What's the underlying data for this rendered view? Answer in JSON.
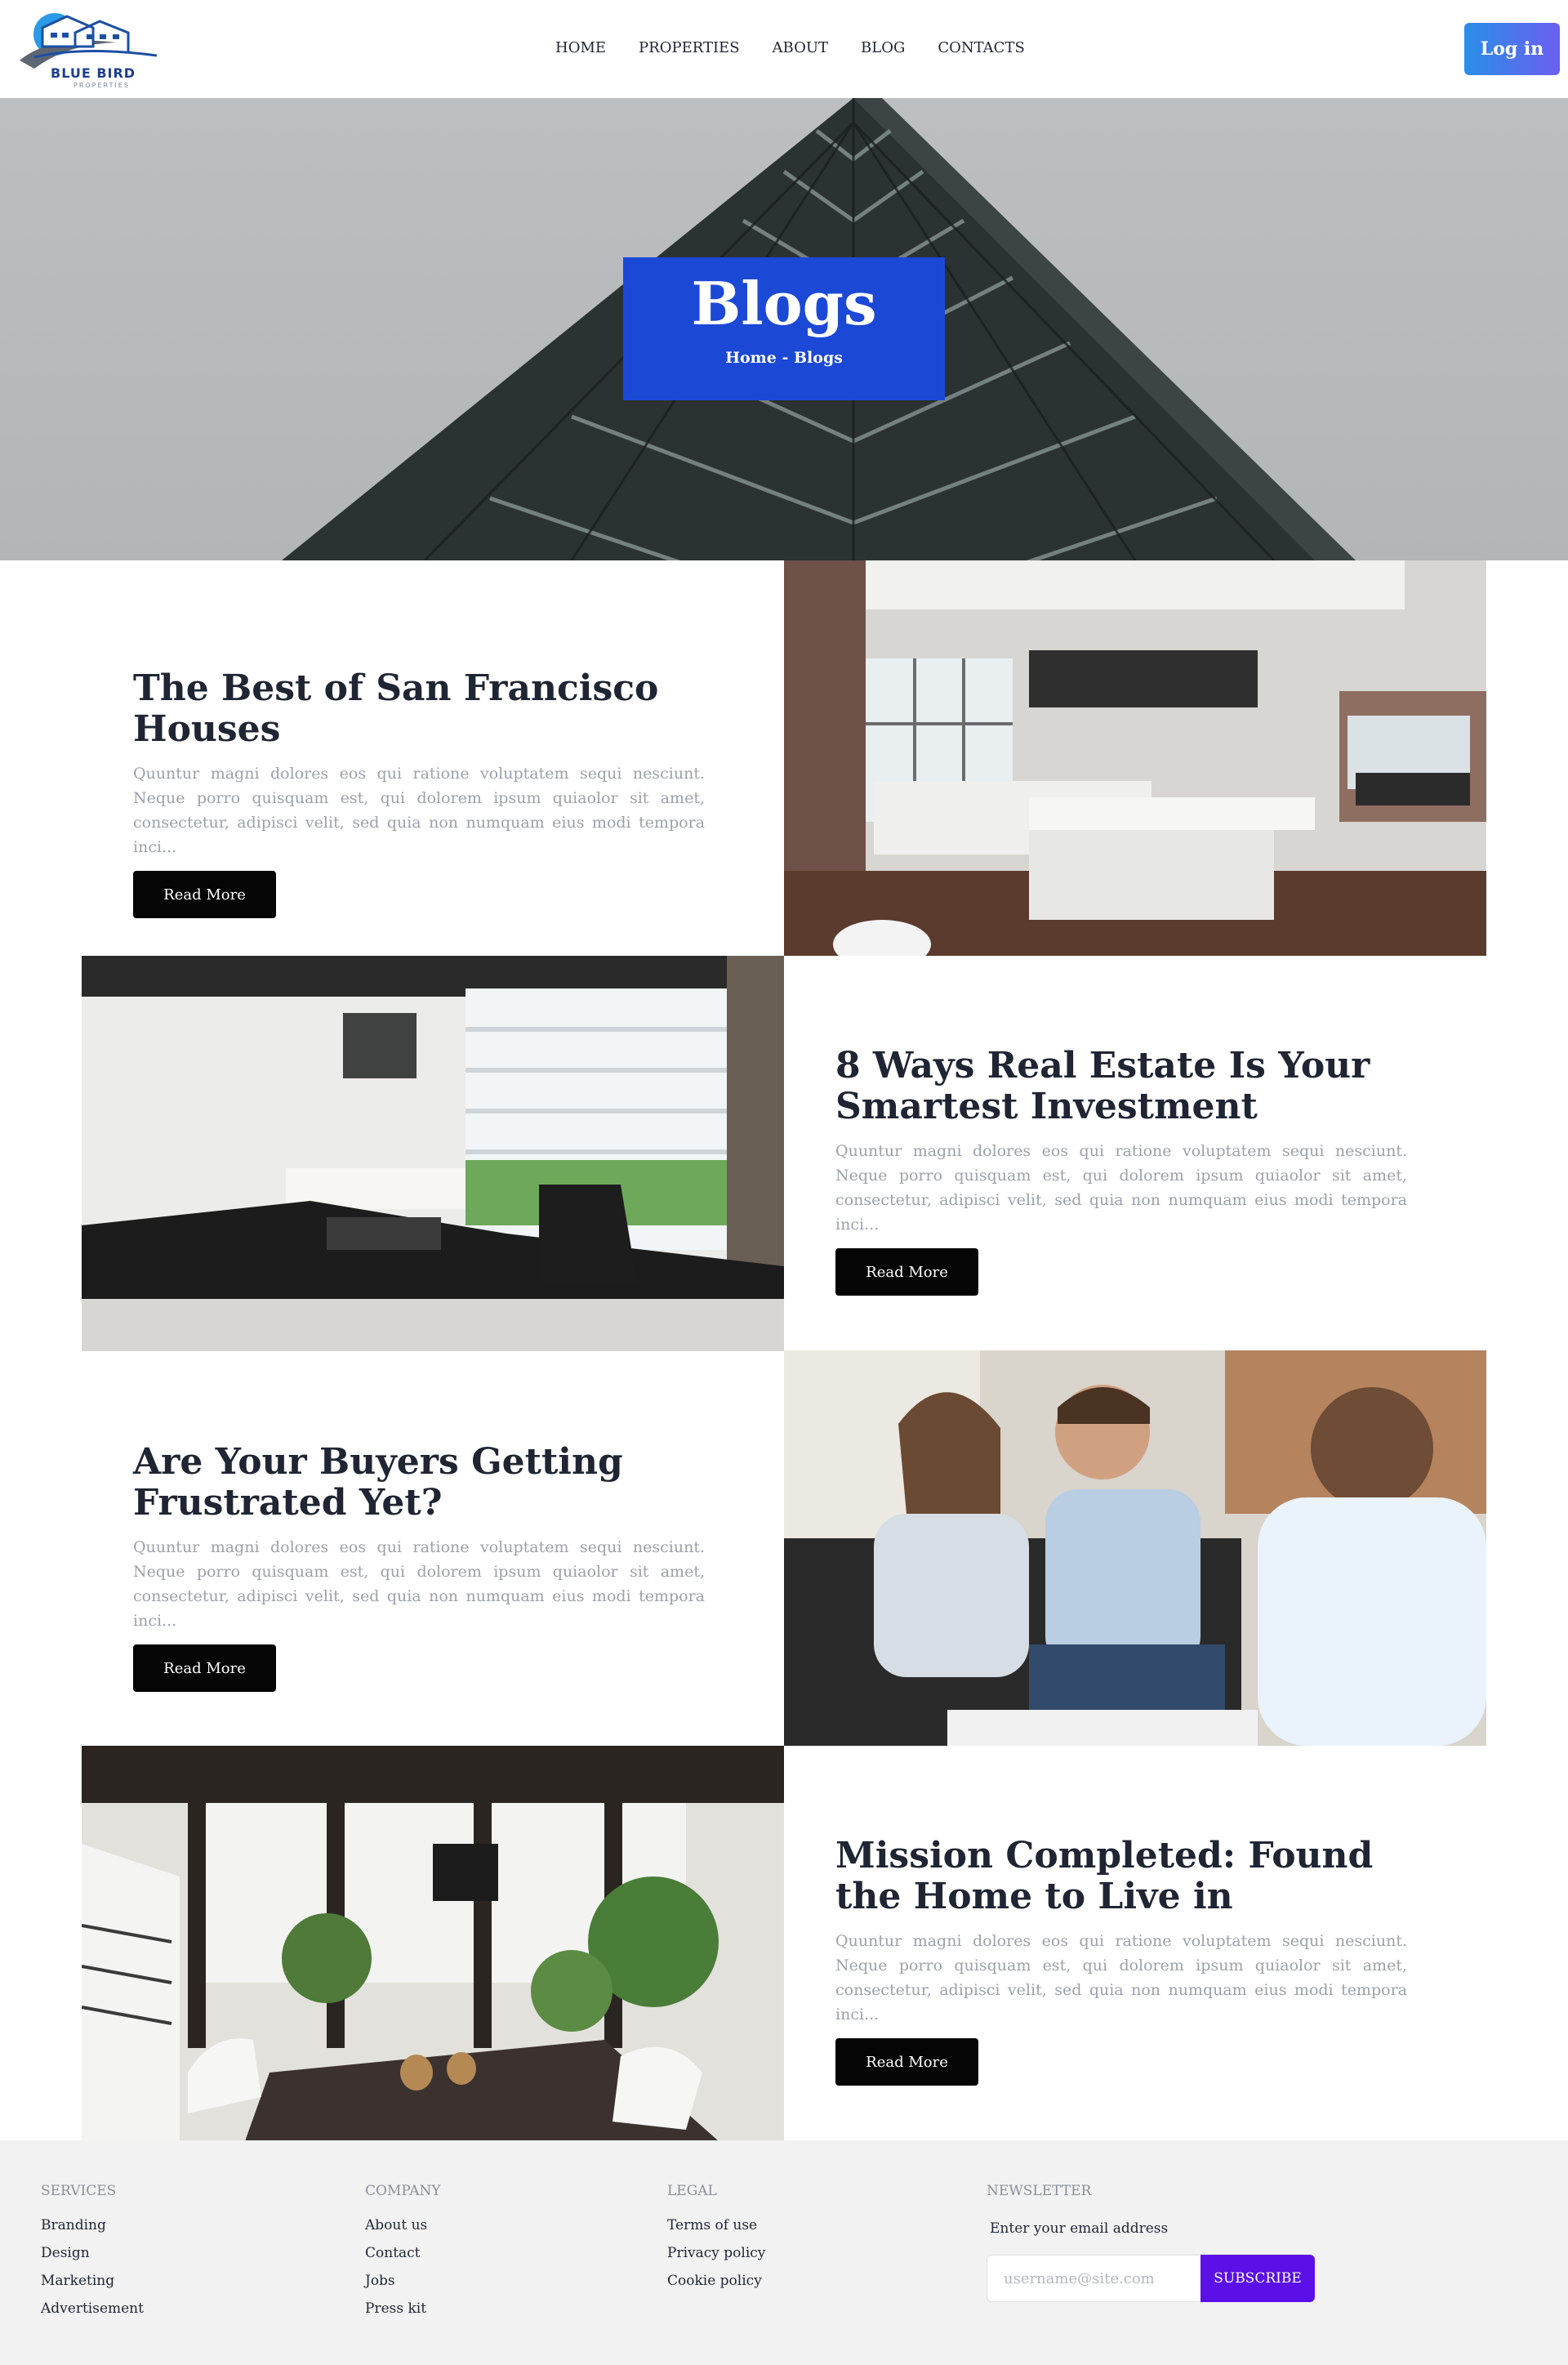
{
  "brand": {
    "name": "BLUE BIRD",
    "tagline": "PROPERTIES"
  },
  "nav": {
    "items": [
      "HOME",
      "PROPERTIES",
      "ABOUT",
      "BLOG",
      "CONTACTS"
    ],
    "login_label": "Log in"
  },
  "hero": {
    "title": "Blogs",
    "breadcrumb": "Home - Blogs"
  },
  "posts": [
    {
      "title": "The Best of San Francisco Houses",
      "excerpt": "Quuntur magni dolores eos qui ratione voluptatem sequi nesciunt. Neque porro quisquam est, qui dolorem ipsum quiaolor sit amet, consectetur, adipisci velit, sed quia non numquam eius modi tempora inci...",
      "button": "Read More"
    },
    {
      "title": "8 Ways Real Estate Is Your Smartest Investment",
      "excerpt": "Quuntur magni dolores eos qui ratione voluptatem sequi nesciunt. Neque porro quisquam est, qui dolorem ipsum quiaolor sit amet, consectetur, adipisci velit, sed quia non numquam eius modi tempora inci...",
      "button": "Read More"
    },
    {
      "title": "Are Your Buyers Getting Frustrated Yet?",
      "excerpt": "Quuntur magni dolores eos qui ratione voluptatem sequi nesciunt. Neque porro quisquam est, qui dolorem ipsum quiaolor sit amet, consectetur, adipisci velit, sed quia non numquam eius modi tempora inci...",
      "button": "Read More"
    },
    {
      "title": "Mission Completed: Found the Home to Live in",
      "excerpt": "Quuntur magni dolores eos qui ratione voluptatem sequi nesciunt. Neque porro quisquam est, qui dolorem ipsum quiaolor sit amet, consectetur, adipisci velit, sed quia non numquam eius modi tempora inci...",
      "button": "Read More"
    }
  ],
  "footer": {
    "services": {
      "heading": "SERVICES",
      "links": [
        "Branding",
        "Design",
        "Marketing",
        "Advertisement"
      ]
    },
    "company": {
      "heading": "COMPANY",
      "links": [
        "About us",
        "Contact",
        "Jobs",
        "Press kit"
      ]
    },
    "legal": {
      "heading": "LEGAL",
      "links": [
        "Terms of use",
        "Privacy policy",
        "Cookie policy"
      ]
    },
    "newsletter": {
      "heading": "NEWSLETTER",
      "label": "Enter your email address",
      "placeholder": "username@site.com",
      "button": "SUBSCRIBE"
    }
  },
  "colors": {
    "accent_blue": "#1b49d6",
    "subscribe_purple": "#5a10e6",
    "button_black": "#050505"
  }
}
